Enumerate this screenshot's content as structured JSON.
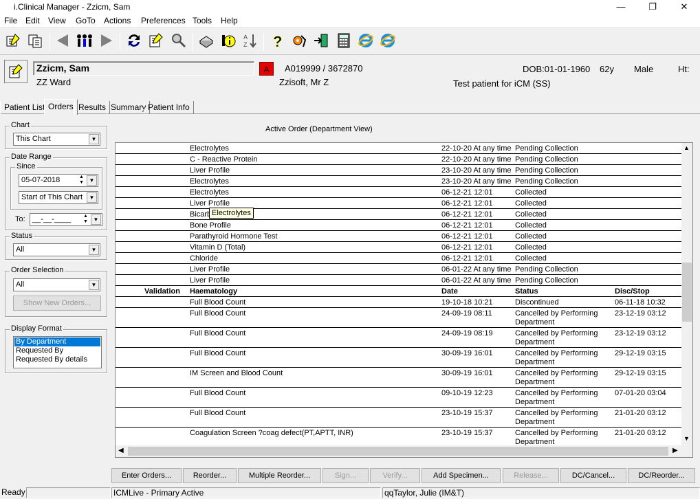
{
  "window": {
    "title": "i.Clinical Manager - Zzicm, Sam",
    "minimize": "—",
    "maximize": "❐",
    "close": "✕"
  },
  "menu": [
    "File",
    "Edit",
    "View",
    "GoTo",
    "Actions",
    "Preferences",
    "Tools",
    "Help"
  ],
  "toolbar_icons": [
    "patient-list-icon",
    "multi-patient-icon",
    "back-arrow-icon",
    "people-icon",
    "forward-arrow-icon",
    "refresh-icon",
    "edit-note-icon",
    "search-icon",
    "print-icon",
    "info-icon",
    "sort-icon",
    "help-icon",
    "settings-icon",
    "exit-icon",
    "calculator-icon",
    "internet-explorer-icon",
    "internet-explorer-icon"
  ],
  "patient": {
    "name": "Zzicm, Sam",
    "ward": "ZZ Ward",
    "alert": "A",
    "ids": "A019999 / 3672870",
    "consultant": "Zzisoft, Mr Z",
    "dob": "DOB:01-01-1960",
    "age": "62y",
    "sex": "Male",
    "ht": "Ht:",
    "note": "Test patient for iCM (SS)"
  },
  "tabs": [
    "Patient List",
    "Orders",
    "Results",
    "Summary",
    "Patient Info"
  ],
  "active_tab": "Orders",
  "filters": {
    "chart_label": "Chart",
    "chart_value": "This Chart",
    "date_range_label": "Date Range",
    "since_label": "Since",
    "since_date": "05-07-2018",
    "since_option": "Start of This Chart",
    "to_label": "To:",
    "to_value": "__-__-____",
    "status_label": "Status",
    "status_value": "All",
    "order_selection_label": "Order Selection",
    "order_selection_value": "All",
    "show_new_orders": "Show New Orders...",
    "display_format_label": "Display Format",
    "display_format_options": [
      "By Department",
      "Requested By",
      "Requested By details"
    ],
    "display_format_selected": "By Department"
  },
  "list": {
    "title": "Active Order (Department View)",
    "rows": [
      {
        "test": "Electrolytes",
        "date": "22-10-20 At any time",
        "status": "Pending Collection"
      },
      {
        "test": "C - Reactive Protein",
        "date": "22-10-20 At any time",
        "status": "Pending Collection"
      },
      {
        "test": "Liver Profile",
        "date": "23-10-20 At any time",
        "status": "Pending Collection"
      },
      {
        "test": "Electrolytes",
        "date": "23-10-20 At any time",
        "status": "Pending Collection"
      },
      {
        "test": "Electrolytes",
        "date": "06-12-21 12:01",
        "status": "Collected"
      },
      {
        "test": "Liver Profile",
        "date": "06-12-21 12:01",
        "status": "Collected"
      },
      {
        "test": "Bicarb",
        "date": "06-12-21 12:01",
        "status": "Collected"
      },
      {
        "test": "Bone Profile",
        "date": "06-12-21 12:01",
        "status": "Collected"
      },
      {
        "test": "Parathyroid Hormone Test",
        "date": "06-12-21 12:01",
        "status": "Collected"
      },
      {
        "test": "Vitamin D (Total)",
        "date": "06-12-21 12:01",
        "status": "Collected"
      },
      {
        "test": "Chloride",
        "date": "06-12-21 12:01",
        "status": "Collected"
      },
      {
        "test": "Liver Profile",
        "date": "06-01-22 At any time",
        "status": "Pending Collection"
      },
      {
        "test": "Liver Profile",
        "date": "06-01-22 At any time",
        "status": "Pending Collection"
      }
    ],
    "header": {
      "validation": "Validation",
      "department": "Haematology",
      "date": "Date",
      "status": "Status",
      "disc": "Disc/Stop"
    },
    "rows2": [
      {
        "test": "Full Blood Count",
        "date": "19-10-18 10:21",
        "status": "Discontinued",
        "status2": "",
        "disc": "06-11-18 10:32"
      },
      {
        "test": "Full Blood Count",
        "date": "24-09-19 08:11",
        "status": "Cancelled by Performing",
        "status2": "Department",
        "disc": "23-12-19 03:12"
      },
      {
        "test": "Full Blood Count",
        "date": "24-09-19 08:19",
        "status": "Cancelled by Performing",
        "status2": "Department",
        "disc": "23-12-19 03:12"
      },
      {
        "test": "Full Blood Count",
        "date": "30-09-19 16:01",
        "status": "Cancelled by Performing",
        "status2": "Department",
        "disc": "29-12-19 03:15"
      },
      {
        "test": "IM Screen and Blood Count",
        "date": "30-09-19 16:01",
        "status": "Cancelled by Performing",
        "status2": "Department",
        "disc": "29-12-19 03:15"
      },
      {
        "test": "Full Blood Count",
        "date": "09-10-19 12:23",
        "status": "Cancelled by Performing",
        "status2": "Department",
        "disc": "07-01-20 03:04"
      },
      {
        "test": "Full Blood Count",
        "date": "23-10-19 15:37",
        "status": "Cancelled by Performing",
        "status2": "Department",
        "disc": "21-01-20 03:12"
      },
      {
        "test": "Coagulation Screen ?coag defect(PT,APTT, INR)",
        "date": "23-10-19 15:37",
        "status": "Cancelled by Performing",
        "status2": "Department",
        "disc": "21-01-20 03:12"
      }
    ]
  },
  "tooltip": "Electrolytes",
  "buttons": [
    {
      "label": "Enter Orders...",
      "enabled": true
    },
    {
      "label": "Reorder...",
      "enabled": true
    },
    {
      "label": "Multiple Reorder...",
      "enabled": true
    },
    {
      "label": "Sign...",
      "enabled": false
    },
    {
      "label": "Verify...",
      "enabled": false
    },
    {
      "label": "Add Specimen...",
      "enabled": true
    },
    {
      "label": "Release...",
      "enabled": false
    },
    {
      "label": "DC/Cancel...",
      "enabled": true
    },
    {
      "label": "DC/Reorder...",
      "enabled": true
    }
  ],
  "statusbar": {
    "ready": "Ready",
    "system": "ICMLive - Primary Active",
    "user": "qqTaylor, Julie (IM&T)"
  }
}
